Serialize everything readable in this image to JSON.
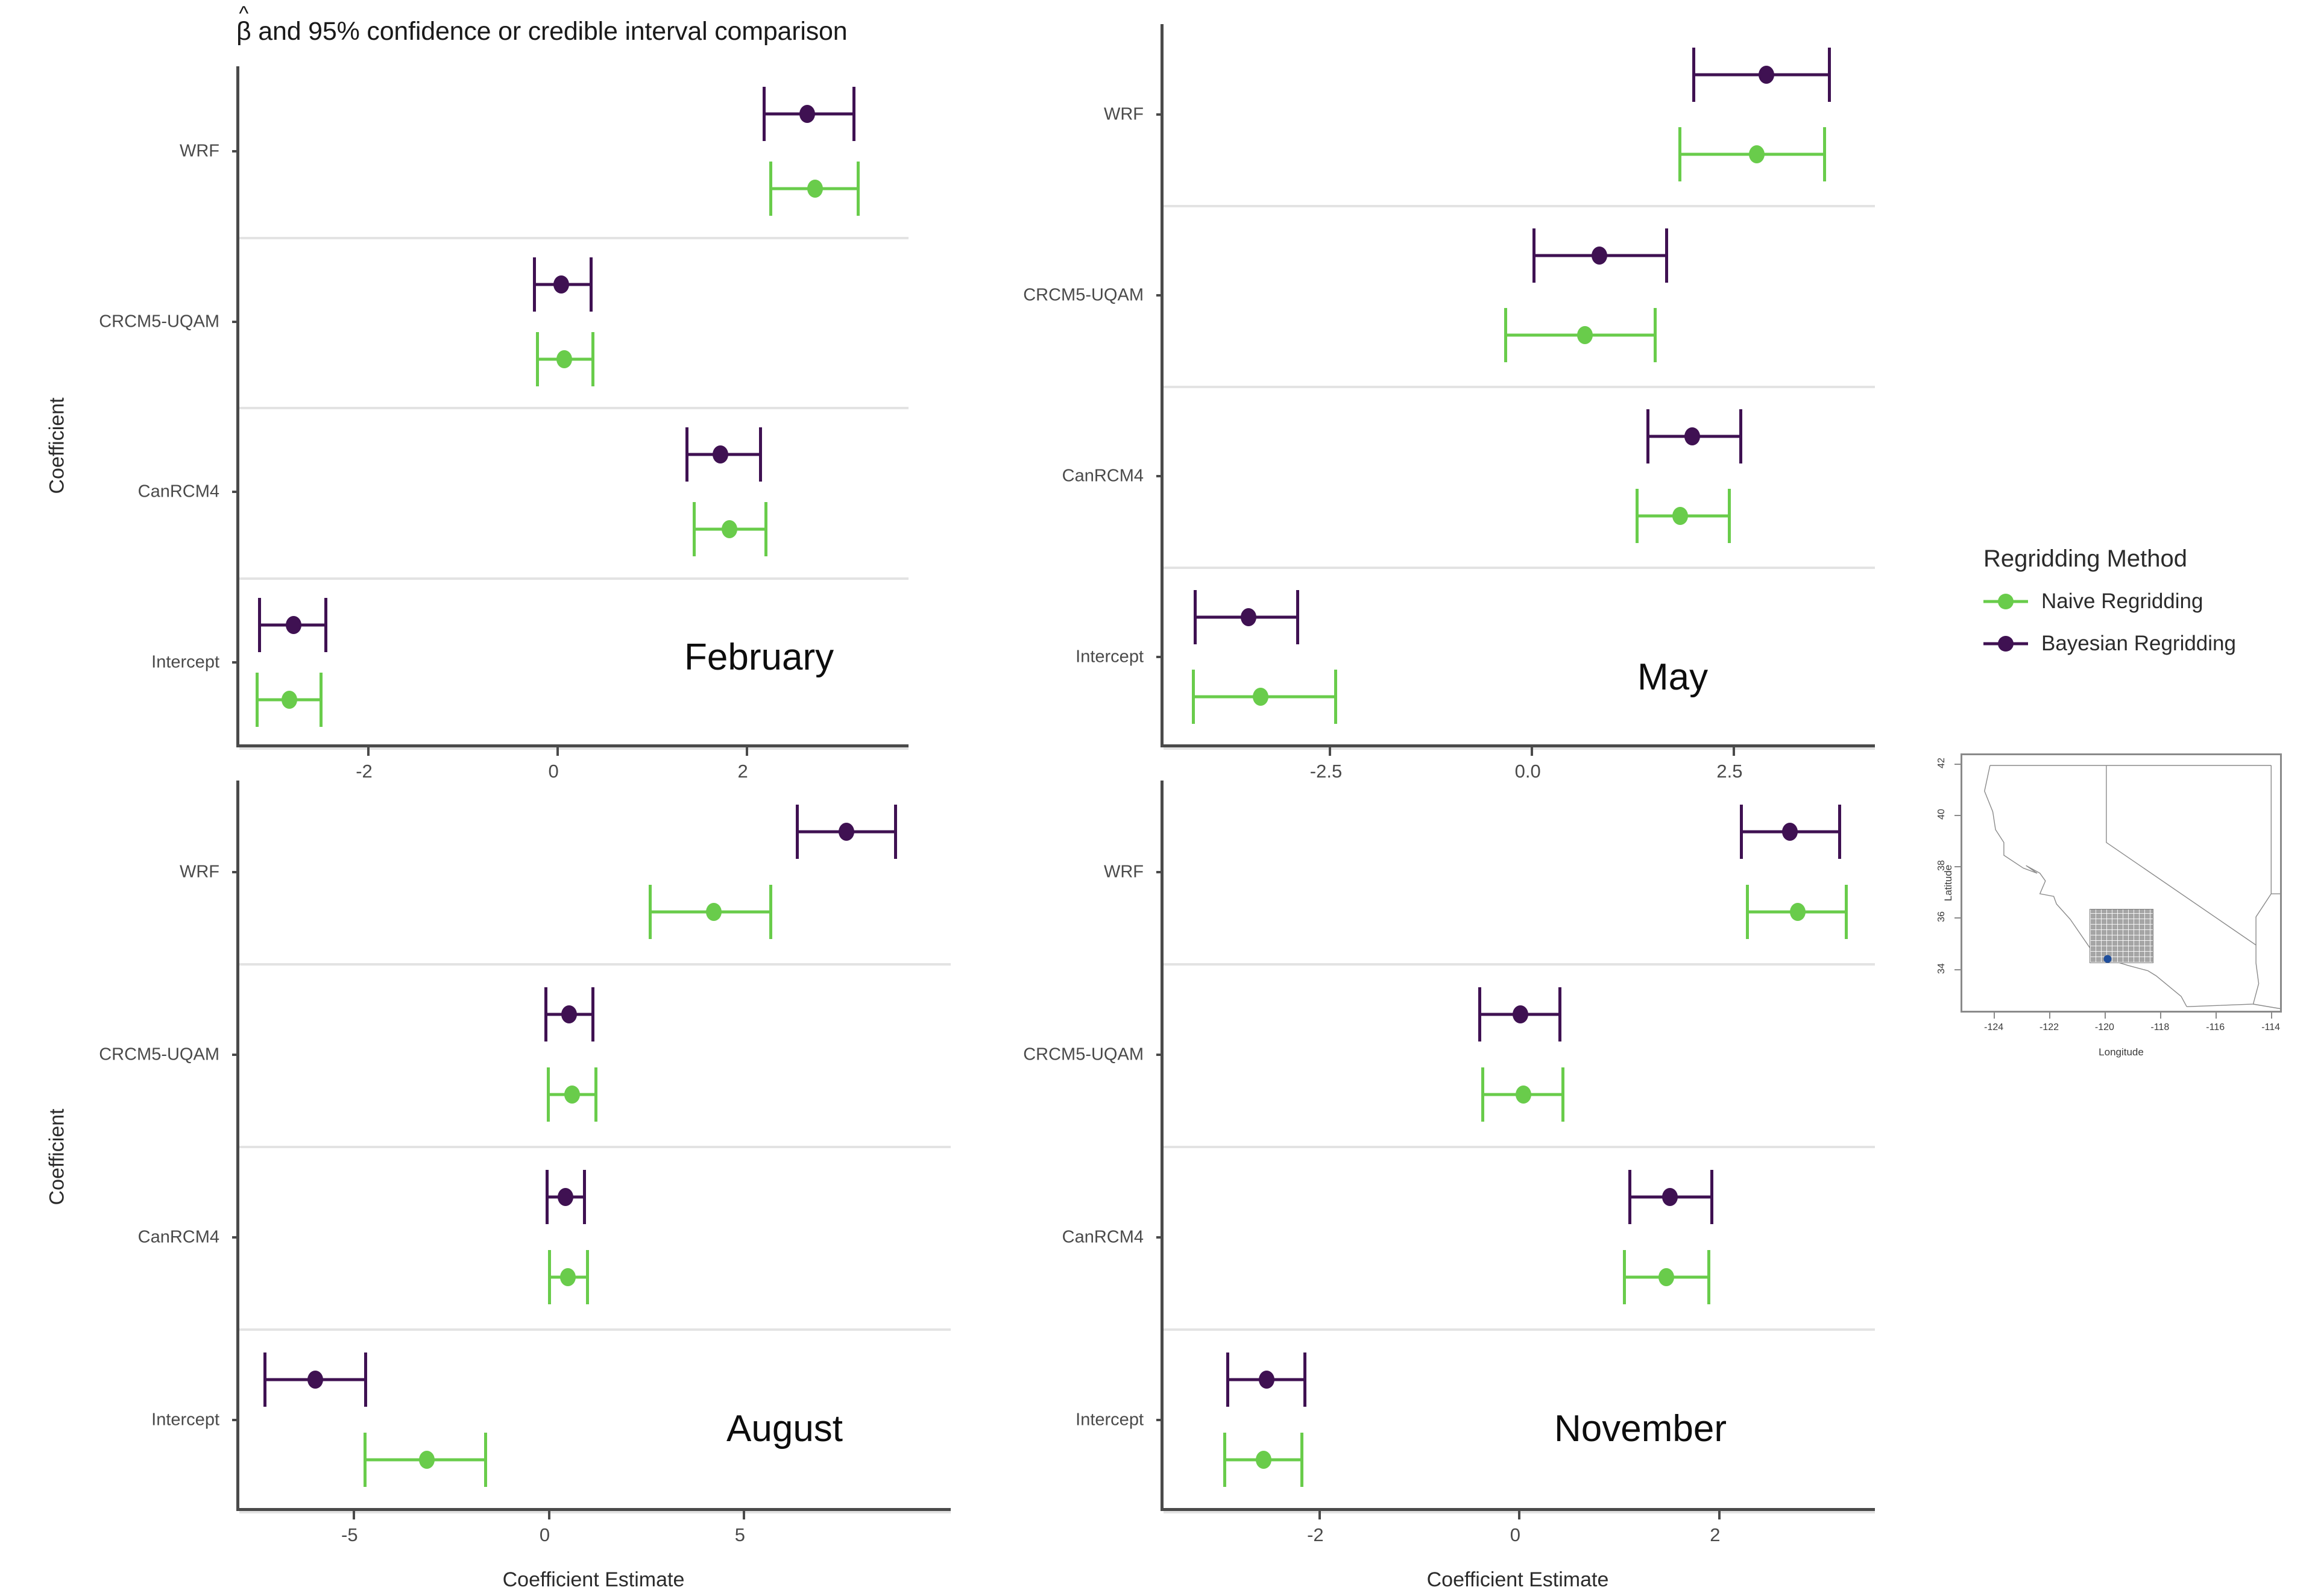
{
  "figure": {
    "title_prefix": "β",
    "title_hat": "^",
    "title_rest": " and 95% confidence or credible interval comparison",
    "axis_y_label": "Coefficient",
    "axis_x_label": "Coefficient Estimate"
  },
  "colors": {
    "naive": "#69CC4B",
    "bayesian": "#3F1152",
    "axis": "#4a4a4a",
    "separator": "#e3e3e3",
    "map_line": "#8a8a8a",
    "map_point": "#1F4E9C",
    "grid_box": "#a5a5a5"
  },
  "legend": {
    "title": "Regridding Method",
    "items": [
      {
        "label": "Naive Regridding",
        "color": "#69CC4B",
        "key": "naive"
      },
      {
        "label": "Bayesian Regridding",
        "color": "#3F1152",
        "key": "bayesian"
      }
    ]
  },
  "categories": [
    "WRF",
    "CRCM5-UQAM",
    "CanRCM4",
    "Intercept"
  ],
  "chart_data": {
    "type": "scatter",
    "title": "β̂ and 95% confidence or credible interval comparison",
    "xlabel": "Coefficient Estimate",
    "ylabel": "Coefficient",
    "grid": false,
    "legend_position": "right",
    "series_names": [
      "Bayesian Regridding",
      "Naive Regridding"
    ],
    "panels": [
      {
        "month": "February",
        "xlim": [
          -3.35,
          3.75
        ],
        "xticks": [
          -2,
          0,
          2
        ],
        "xticklabels": [
          "-2",
          "0",
          "2"
        ],
        "rows": [
          {
            "category": "WRF",
            "bayesian": {
              "estimate": 2.65,
              "lower": 2.18,
              "upper": 3.16
            },
            "naive": {
              "estimate": 2.73,
              "lower": 2.25,
              "upper": 3.2
            }
          },
          {
            "category": "CRCM5-UQAM",
            "bayesian": {
              "estimate": 0.05,
              "lower": -0.25,
              "upper": 0.38
            },
            "naive": {
              "estimate": 0.08,
              "lower": -0.22,
              "upper": 0.4
            }
          },
          {
            "category": "CanRCM4",
            "bayesian": {
              "estimate": 1.73,
              "lower": 1.36,
              "upper": 2.17
            },
            "naive": {
              "estimate": 1.83,
              "lower": 1.44,
              "upper": 2.23
            }
          },
          {
            "category": "Intercept",
            "bayesian": {
              "estimate": -2.78,
              "lower": -3.15,
              "upper": -2.42
            },
            "naive": {
              "estimate": -2.82,
              "lower": -3.18,
              "upper": -2.47
            }
          }
        ]
      },
      {
        "month": "May",
        "xlim": [
          -4.55,
          4.3
        ],
        "xticks": [
          -2.5,
          0.0,
          2.5
        ],
        "xticklabels": [
          "-2.5",
          "0.0",
          "2.5"
        ],
        "rows": [
          {
            "category": "WRF",
            "bayesian": {
              "estimate": 2.92,
              "lower": 2.0,
              "upper": 3.72
            },
            "naive": {
              "estimate": 2.8,
              "lower": 1.83,
              "upper": 3.66
            }
          },
          {
            "category": "CRCM5-UQAM",
            "bayesian": {
              "estimate": 0.85,
              "lower": 0.02,
              "upper": 1.7
            },
            "naive": {
              "estimate": 0.67,
              "lower": -0.33,
              "upper": 1.56
            }
          },
          {
            "category": "CanRCM4",
            "bayesian": {
              "estimate": 2.0,
              "lower": 1.43,
              "upper": 2.62
            },
            "naive": {
              "estimate": 1.85,
              "lower": 1.3,
              "upper": 2.48
            }
          },
          {
            "category": "Intercept",
            "bayesian": {
              "estimate": -3.5,
              "lower": -4.18,
              "upper": -2.87
            },
            "naive": {
              "estimate": -3.35,
              "lower": -4.2,
              "upper": -2.4
            }
          }
        ]
      },
      {
        "month": "August",
        "xlim": [
          -7.9,
          10.4
        ],
        "xticks": [
          -5,
          0,
          5
        ],
        "xticklabels": [
          "-5",
          "0",
          "5"
        ],
        "rows": [
          {
            "category": "WRF",
            "bayesian": {
              "estimate": 7.65,
              "lower": 6.35,
              "upper": 8.95
            },
            "naive": {
              "estimate": 4.25,
              "lower": 2.58,
              "upper": 5.75
            }
          },
          {
            "category": "CRCM5-UQAM",
            "bayesian": {
              "estimate": 0.55,
              "lower": -0.08,
              "upper": 1.2
            },
            "naive": {
              "estimate": 0.62,
              "lower": -0.02,
              "upper": 1.28
            }
          },
          {
            "category": "CanRCM4",
            "bayesian": {
              "estimate": 0.45,
              "lower": -0.05,
              "upper": 0.98
            },
            "naive": {
              "estimate": 0.52,
              "lower": 0.0,
              "upper": 1.05
            }
          },
          {
            "category": "Intercept",
            "bayesian": {
              "estimate": -5.95,
              "lower": -7.28,
              "upper": -4.62
            },
            "naive": {
              "estimate": -3.1,
              "lower": -4.72,
              "upper": -1.55
            }
          }
        ]
      },
      {
        "month": "November",
        "xlim": [
          -3.55,
          3.6
        ],
        "xticks": [
          -2,
          0,
          2
        ],
        "xticklabels": [
          "-2",
          "0",
          "2"
        ],
        "rows": [
          {
            "category": "WRF",
            "bayesian": {
              "estimate": 2.72,
              "lower": 2.22,
              "upper": 3.23
            },
            "naive": {
              "estimate": 2.8,
              "lower": 2.28,
              "upper": 3.3
            }
          },
          {
            "category": "CRCM5-UQAM",
            "bayesian": {
              "estimate": 0.02,
              "lower": -0.4,
              "upper": 0.43
            },
            "naive": {
              "estimate": 0.05,
              "lower": -0.37,
              "upper": 0.46
            }
          },
          {
            "category": "CanRCM4",
            "bayesian": {
              "estimate": 1.52,
              "lower": 1.1,
              "upper": 1.95
            },
            "naive": {
              "estimate": 1.48,
              "lower": 1.05,
              "upper": 1.92
            }
          },
          {
            "category": "Intercept",
            "bayesian": {
              "estimate": -2.52,
              "lower": -2.92,
              "upper": -2.12
            },
            "naive": {
              "estimate": -2.55,
              "lower": -2.95,
              "upper": -2.15
            }
          }
        ]
      }
    ]
  },
  "inset_map": {
    "xlabel": "Longitude",
    "ylabel": "Latitude",
    "lat_ticks": [
      "34",
      "36",
      "38",
      "40",
      "42"
    ],
    "lon_ticks": [
      "-124",
      "-122",
      "-120",
      "-118",
      "-116",
      "-114"
    ],
    "lat_range": [
      32.3,
      42.4
    ],
    "lon_range": [
      -125.2,
      -113.6
    ],
    "study_box": {
      "lon_min": -120.6,
      "lon_max": -118.3,
      "lat_min": 34.3,
      "lat_max": 36.4
    },
    "point": {
      "lon": -119.95,
      "lat": 34.45
    }
  }
}
